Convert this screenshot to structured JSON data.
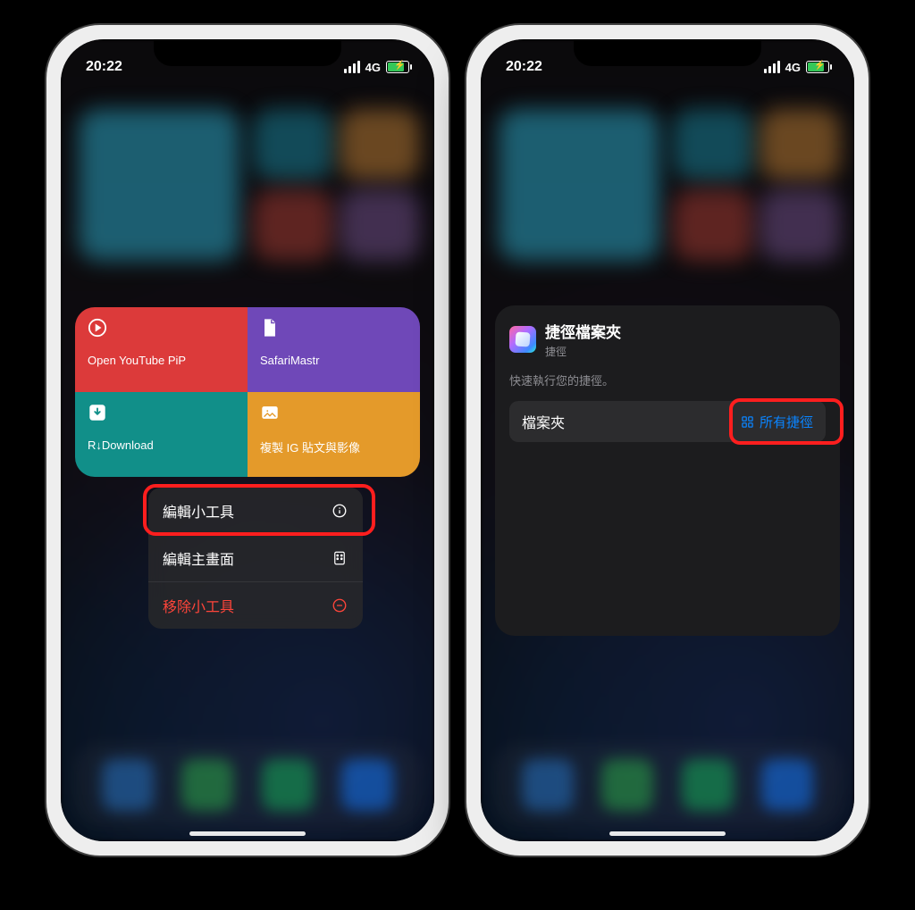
{
  "status": {
    "time": "20:22",
    "network": "4G"
  },
  "left": {
    "tiles": [
      {
        "label": "Open YouTube PiP",
        "icon": "play-circle-icon",
        "color": "red"
      },
      {
        "label": "SafariMastr",
        "icon": "document-icon",
        "color": "purple"
      },
      {
        "label": "R↓Download",
        "icon": "download-box-icon",
        "color": "teal"
      },
      {
        "label": "複製 IG 貼文與影像",
        "icon": "image-icon",
        "color": "orange"
      }
    ],
    "menu": {
      "edit_widget": "編輯小工具",
      "edit_home": "編輯主畫面",
      "remove_widget": "移除小工具"
    }
  },
  "right": {
    "card": {
      "title": "捷徑檔案夾",
      "subtitle": "捷徑",
      "desc": "快速執行您的捷徑。",
      "row_label": "檔案夾",
      "row_value": "所有捷徑"
    }
  }
}
